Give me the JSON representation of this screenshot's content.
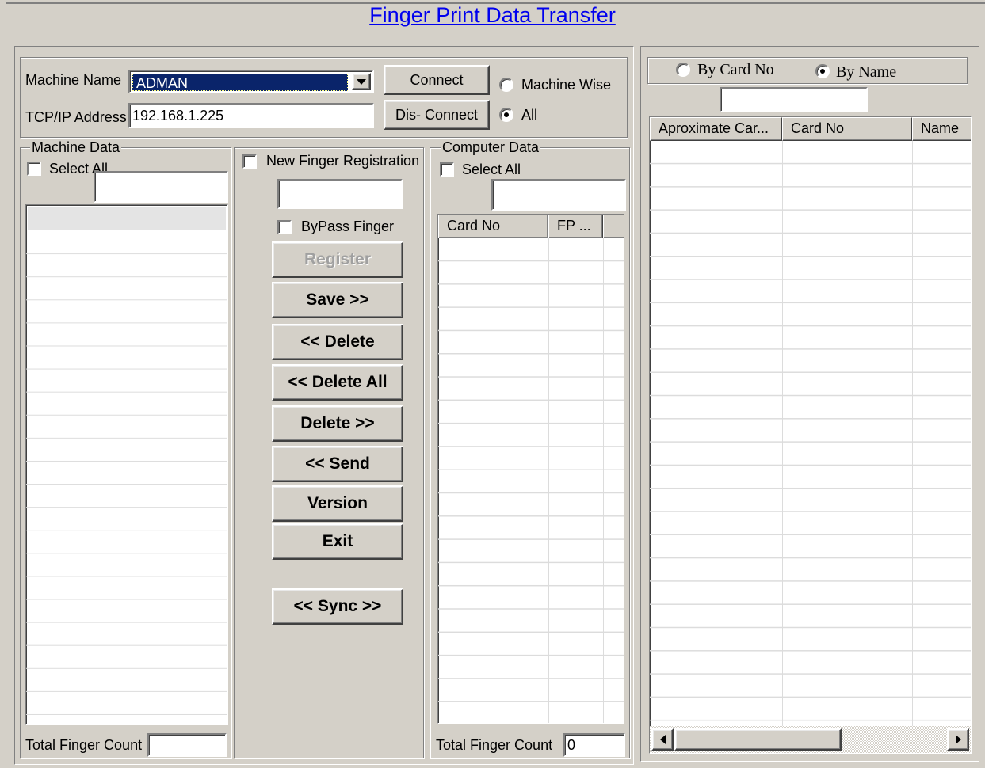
{
  "title": "Finger Print Data Transfer",
  "connection": {
    "machine_name_label": "Machine Name",
    "machine_name_value": "ADMAN",
    "tcpip_label": "TCP/IP Address",
    "tcpip_value": "192.168.1.225",
    "connect_label": "Connect",
    "disconnect_label": "Dis- Connect",
    "mode_options": [
      {
        "label": "Machine Wise",
        "selected": false
      },
      {
        "label": "All",
        "selected": true
      }
    ]
  },
  "machine_data": {
    "group_title": "Machine Data",
    "select_all_label": "Select All",
    "select_all_checked": false,
    "filter_value": "",
    "total_label": "Total Finger Count",
    "total_value": ""
  },
  "actions": {
    "new_registration_label": "New Finger Registration",
    "new_registration_checked": false,
    "registration_value": "",
    "bypass_label": "ByPass Finger",
    "bypass_checked": false,
    "buttons": {
      "register": "Register",
      "save": "Save >>",
      "delete_left": "<< Delete",
      "delete_all": "<< Delete All",
      "delete_right": "Delete >>",
      "send": "<< Send",
      "version": "Version",
      "exit": "Exit",
      "sync": "<< Sync >>"
    }
  },
  "computer_data": {
    "group_title": "Computer Data",
    "select_all_label": "Select All",
    "select_all_checked": false,
    "filter_value": "",
    "columns": [
      "Card No",
      "FP ..."
    ],
    "total_label": "Total Finger Count",
    "total_value": "0"
  },
  "search": {
    "options": [
      {
        "label": "By Card No",
        "selected": false
      },
      {
        "label": "By Name",
        "selected": true
      }
    ],
    "search_value": "",
    "columns": [
      "Aproximate Car...",
      "Card No",
      "Name"
    ]
  },
  "colors": {
    "face": "#d4d0c8",
    "title_link": "#0000ee",
    "selection": "#0a246a"
  }
}
